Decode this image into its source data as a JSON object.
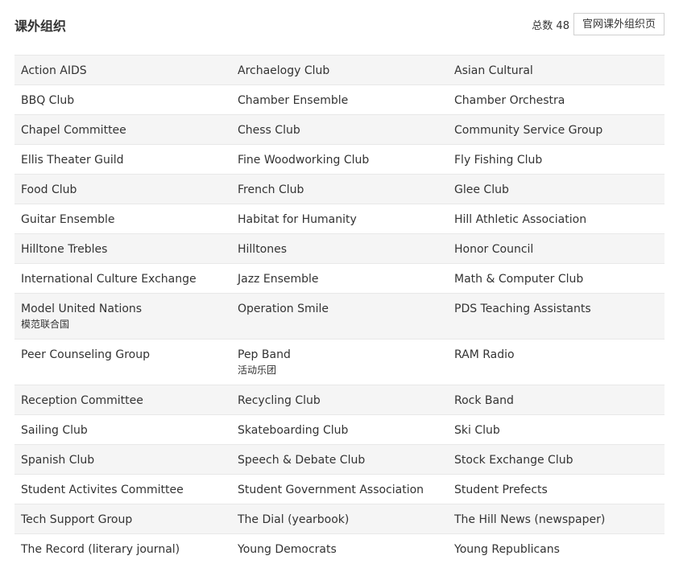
{
  "header": {
    "title": "课外组织",
    "total_label": "总数 48",
    "official_page_button": "官网课外组织页"
  },
  "rows": [
    [
      {
        "name": "Action AIDS"
      },
      {
        "name": "Archaelogy Club"
      },
      {
        "name": "Asian Cultural"
      }
    ],
    [
      {
        "name": "BBQ Club"
      },
      {
        "name": "Chamber Ensemble"
      },
      {
        "name": "Chamber Orchestra"
      }
    ],
    [
      {
        "name": "Chapel Committee"
      },
      {
        "name": "Chess Club"
      },
      {
        "name": "Community Service Group"
      }
    ],
    [
      {
        "name": "Ellis Theater Guild"
      },
      {
        "name": "Fine Woodworking Club"
      },
      {
        "name": "Fly Fishing Club"
      }
    ],
    [
      {
        "name": "Food Club"
      },
      {
        "name": "French Club"
      },
      {
        "name": "Glee Club"
      }
    ],
    [
      {
        "name": "Guitar Ensemble"
      },
      {
        "name": "Habitat for Humanity"
      },
      {
        "name": "Hill Athletic Association"
      }
    ],
    [
      {
        "name": "Hilltone Trebles"
      },
      {
        "name": "Hilltones"
      },
      {
        "name": "Honor Council"
      }
    ],
    [
      {
        "name": "International Culture Exchange"
      },
      {
        "name": "Jazz Ensemble"
      },
      {
        "name": "Math & Computer Club"
      }
    ],
    [
      {
        "name": "Model United Nations",
        "sub": "模范联合国"
      },
      {
        "name": "Operation Smile"
      },
      {
        "name": "PDS Teaching Assistants"
      }
    ],
    [
      {
        "name": "Peer Counseling Group"
      },
      {
        "name": "Pep Band",
        "sub": "活动乐团"
      },
      {
        "name": "RAM Radio"
      }
    ],
    [
      {
        "name": "Reception Committee"
      },
      {
        "name": "Recycling Club"
      },
      {
        "name": "Rock Band"
      }
    ],
    [
      {
        "name": "Sailing Club"
      },
      {
        "name": "Skateboarding Club"
      },
      {
        "name": "Ski Club"
      }
    ],
    [
      {
        "name": "Spanish Club"
      },
      {
        "name": "Speech & Debate Club"
      },
      {
        "name": "Stock Exchange Club"
      }
    ],
    [
      {
        "name": "Student Activites Committee"
      },
      {
        "name": "Student Government Association"
      },
      {
        "name": "Student Prefects"
      }
    ],
    [
      {
        "name": "Tech Support Group"
      },
      {
        "name": "The Dial (yearbook)"
      },
      {
        "name": "The Hill News (newspaper)"
      }
    ],
    [
      {
        "name": "The Record (literary journal)"
      },
      {
        "name": "Young Democrats"
      },
      {
        "name": "Young Republicans"
      }
    ]
  ]
}
